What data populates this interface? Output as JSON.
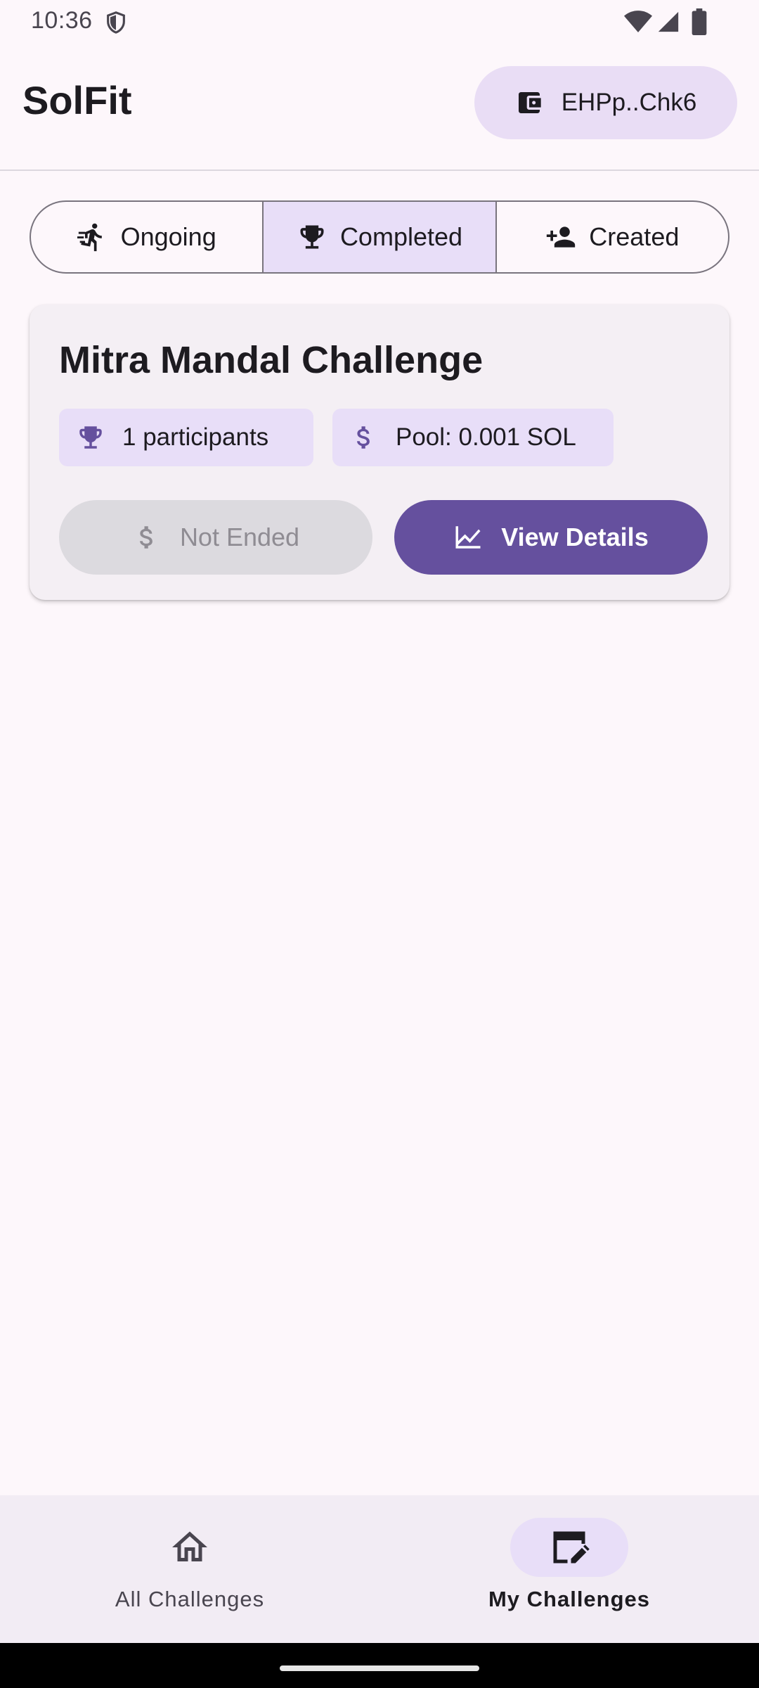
{
  "status_bar": {
    "time": "10:36",
    "icons": [
      "shield-icon",
      "wifi-icon",
      "signal-icon",
      "battery-icon"
    ]
  },
  "app_bar": {
    "title": "SolFit",
    "wallet": {
      "icon": "wallet-icon",
      "label": "EHPp..Chk6"
    }
  },
  "tabs": [
    {
      "label": "Ongoing",
      "icon": "running-icon",
      "selected": false
    },
    {
      "label": "Completed",
      "icon": "trophy-icon",
      "selected": true
    },
    {
      "label": "Created",
      "icon": "person-add-icon",
      "selected": false
    }
  ],
  "challenge_card": {
    "title": "Mitra Mandal Challenge",
    "participants_chip": {
      "icon": "trophy-icon",
      "label": "1 participants"
    },
    "pool_chip": {
      "icon": "dollar-icon",
      "label": "Pool: 0.001 SOL"
    },
    "claim_button": {
      "icon": "dollar-icon",
      "label": "Not Ended",
      "enabled": false
    },
    "details_button": {
      "icon": "chart-icon",
      "label": "View Details"
    }
  },
  "bottom_nav": [
    {
      "label": "All Challenges",
      "icon": "home-icon",
      "selected": false
    },
    {
      "label": "My Challenges",
      "icon": "edit-note-icon",
      "selected": true
    }
  ],
  "colors": {
    "background": "#fdf7fb",
    "primary": "#65509e",
    "secondary_container": "#e8def8",
    "wallet_container": "#e9ddf5",
    "card_surface": "#f4eff4",
    "disabled_container": "#dcdadf",
    "nav_surface": "#f2ecf4"
  }
}
